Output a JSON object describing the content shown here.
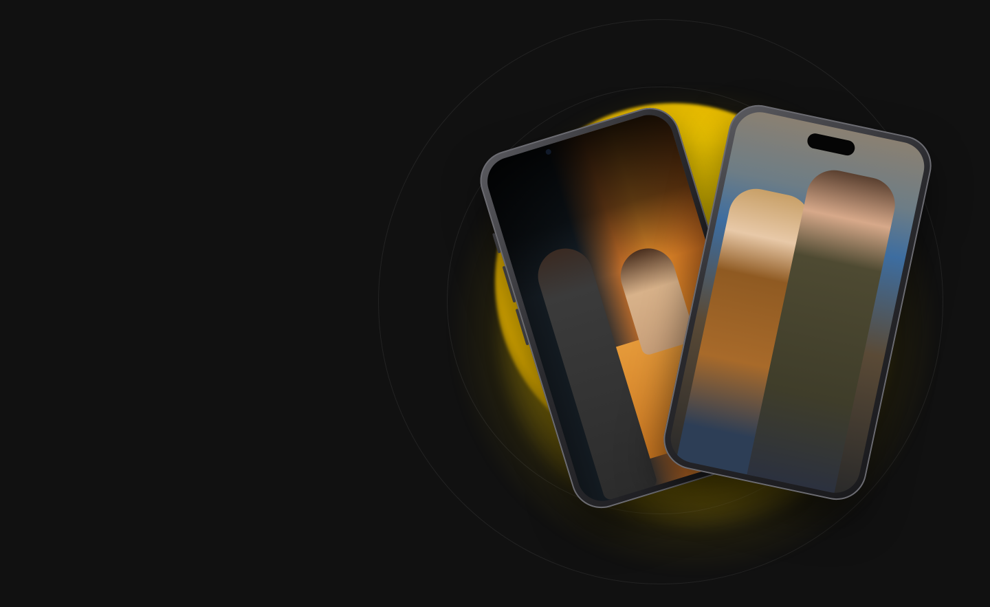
{
  "scene": {
    "background_color": "#111111",
    "accent_color": "#FFD600",
    "phones": [
      {
        "name": "left-phone",
        "scene": "store-counter",
        "icon": "phone-icon"
      },
      {
        "name": "right-phone",
        "scene": "mall-couple",
        "icon": "phone-icon"
      }
    ]
  }
}
